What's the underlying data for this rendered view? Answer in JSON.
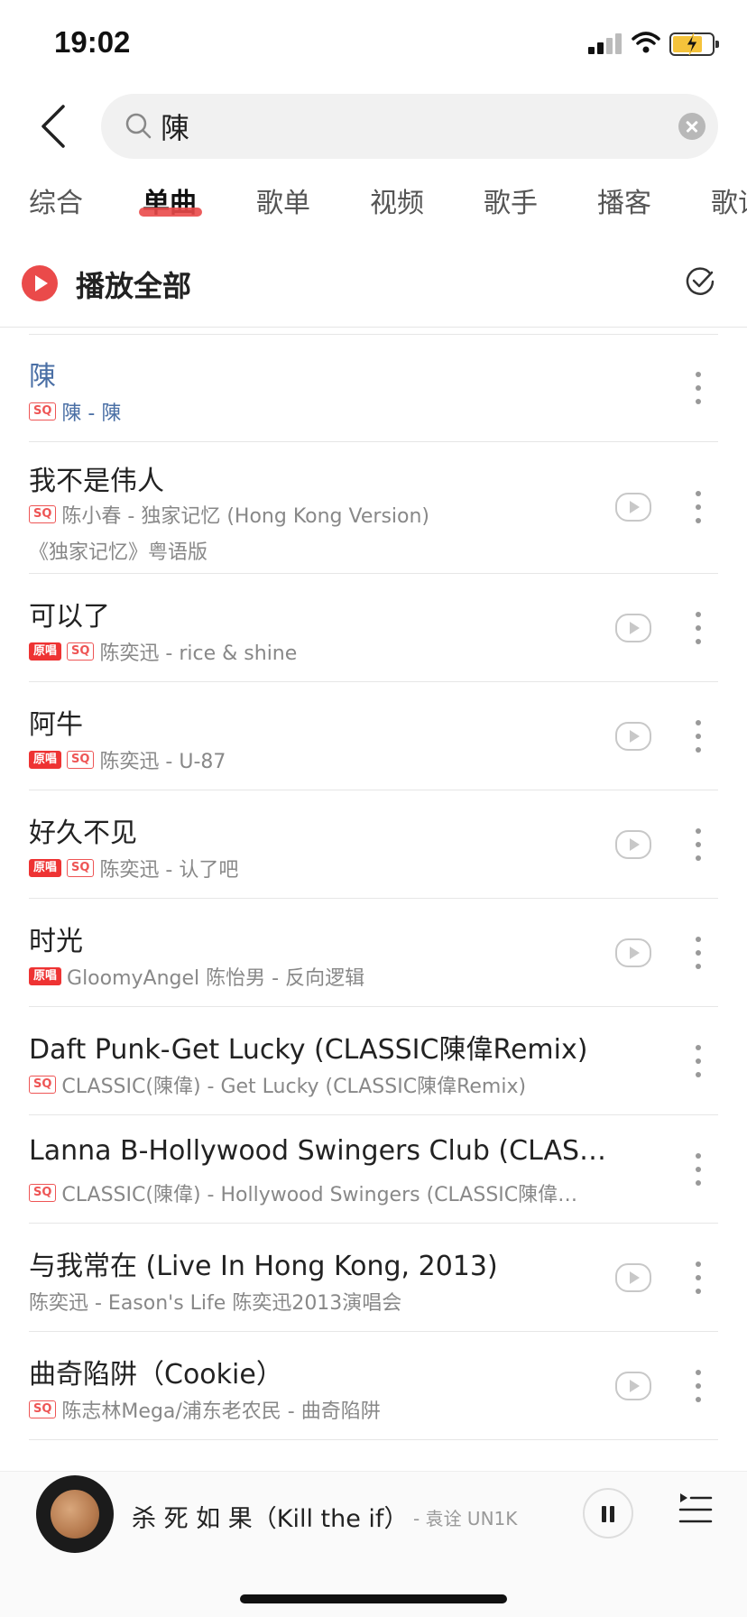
{
  "status_bar": {
    "time": "19:02"
  },
  "search": {
    "query": "陳",
    "placeholder": ""
  },
  "tabs": [
    {
      "label": "综合",
      "active": false
    },
    {
      "label": "单曲",
      "active": true
    },
    {
      "label": "歌单",
      "active": false
    },
    {
      "label": "视频",
      "active": false
    },
    {
      "label": "歌手",
      "active": false
    },
    {
      "label": "播客",
      "active": false
    },
    {
      "label": "歌词",
      "active": false
    }
  ],
  "play_all": {
    "label": "播放全部"
  },
  "songs": [
    {
      "title": "陳",
      "title_highlight": true,
      "tags": [
        "SQ"
      ],
      "artist_album": "陳 - 陳",
      "meta_highlight": true,
      "subtitle": "",
      "has_mv": false
    },
    {
      "title": "我不是伟人",
      "tags": [
        "SQ"
      ],
      "artist_album": "陈小春 - 独家记忆 (Hong Kong Version)",
      "subtitle": "《独家记忆》粤语版",
      "has_mv": true
    },
    {
      "title": "可以了",
      "tags": [
        "原唱",
        "SQ"
      ],
      "artist_album": "陈奕迅 - rice & shine",
      "subtitle": "",
      "has_mv": true
    },
    {
      "title": "阿牛",
      "tags": [
        "原唱",
        "SQ"
      ],
      "artist_album": "陈奕迅 - U-87",
      "subtitle": "",
      "has_mv": true
    },
    {
      "title": "好久不见",
      "tags": [
        "原唱",
        "SQ"
      ],
      "artist_album": "陈奕迅 - 认了吧",
      "subtitle": "",
      "has_mv": true
    },
    {
      "title": "时光",
      "tags": [
        "原唱"
      ],
      "artist_album": "GloomyAngel 陈怡男 - 反向逻辑",
      "subtitle": "",
      "has_mv": true
    },
    {
      "title": "Daft Punk-Get Lucky (CLASSIC陳偉Remix)",
      "tags": [
        "SQ"
      ],
      "artist_album": "CLASSIC(陳偉) - Get Lucky (CLASSIC陳偉Remix)",
      "subtitle": "",
      "has_mv": false
    },
    {
      "title": "Lanna B-Hollywood Swingers Club (CLAS…",
      "tags": [
        "SQ"
      ],
      "artist_album": "CLASSIC(陳偉) - Hollywood Swingers (CLASSIC陳偉…",
      "subtitle": "",
      "has_mv": false
    },
    {
      "title": "与我常在 (Live In Hong Kong, 2013)",
      "tags": [],
      "artist_album": "陈奕迅 - Eason's Life 陈奕迅2013演唱会",
      "subtitle": "",
      "has_mv": true
    },
    {
      "title": "曲奇陷阱（Cookie）",
      "tags": [
        "SQ"
      ],
      "artist_album": "陈志林Mega/浦东老农民 - 曲奇陷阱",
      "subtitle": "",
      "has_mv": true
    }
  ],
  "player": {
    "title": "杀 死 如 果（Kill the if）",
    "artist": "- 袁诠 UN1K"
  },
  "colors": {
    "accent_red": "#ea4a4a",
    "highlight_blue": "#4a6fa5"
  }
}
